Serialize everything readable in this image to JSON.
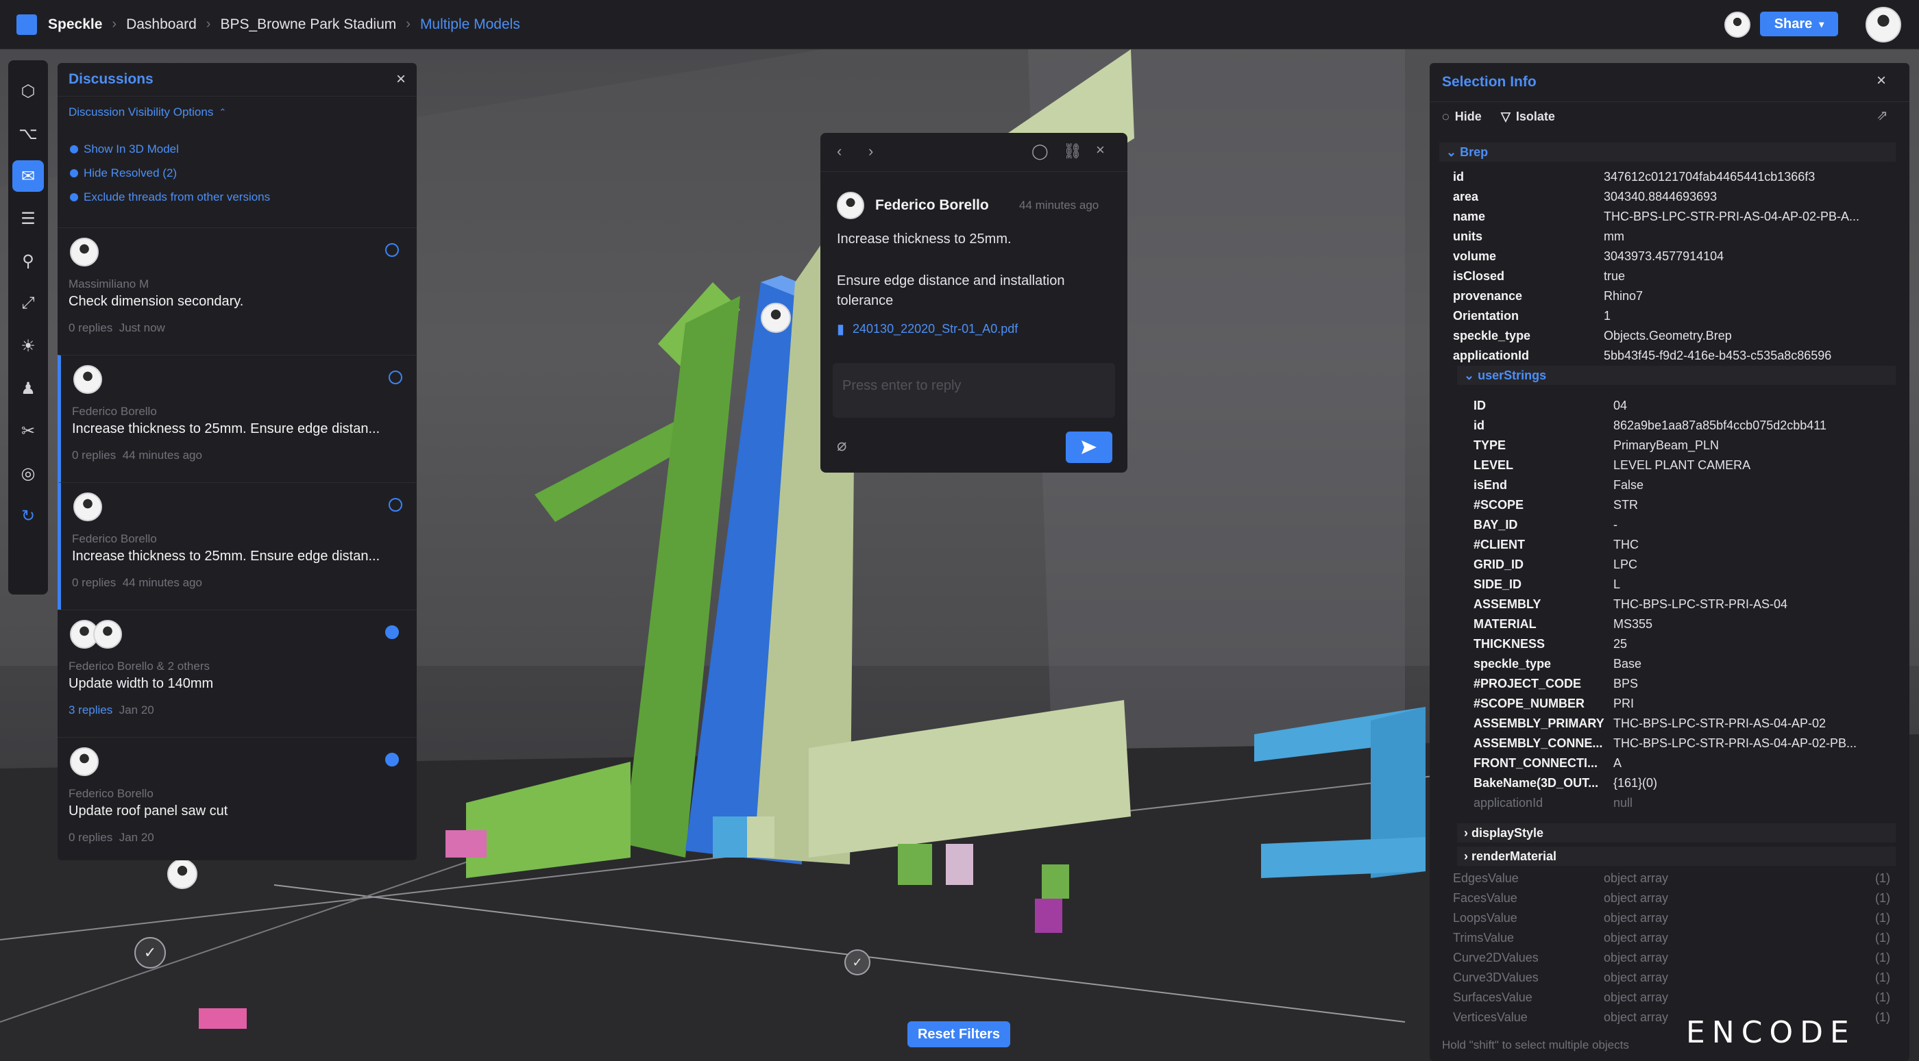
{
  "breadcrumb": {
    "brand": "Speckle",
    "items": [
      "Dashboard",
      "BPS_Browne Park Stadium"
    ],
    "current": "Multiple Models"
  },
  "header": {
    "share_label": "Share"
  },
  "discussions": {
    "title": "Discussions",
    "visibility_label": "Discussion Visibility Options",
    "options": [
      "Show In 3D Model",
      "Hide Resolved (2)",
      "Exclude threads from other versions"
    ],
    "threads": [
      {
        "author": "Massimiliano M",
        "text": "Check dimension secondary.",
        "replies": "0 replies",
        "time": "Just now"
      },
      {
        "author": "Federico Borello",
        "text": "Increase thickness to 25mm. Ensure edge distan...",
        "replies": "0 replies",
        "time": "44 minutes ago"
      },
      {
        "author": "Federico Borello",
        "text": "Increase thickness to 25mm. Ensure edge distan...",
        "replies": "0 replies",
        "time": "44 minutes ago"
      },
      {
        "author": "Federico Borello & 2 others",
        "text": "Update width to 140mm",
        "replies": "3 replies",
        "time": "Jan 20"
      },
      {
        "author": "Federico Borello",
        "text": "Update roof panel saw cut",
        "replies": "0 replies",
        "time": "Jan 20"
      }
    ]
  },
  "comment": {
    "author": "Federico Borello",
    "time": "44 minutes ago",
    "line1": "Increase thickness to 25mm.",
    "line2": "Ensure edge distance and installation tolerance",
    "attachment": "240130_22020_Str-01_A0.pdf",
    "reply_placeholder": "Press enter to reply"
  },
  "selection": {
    "title": "Selection Info",
    "hide_label": "Hide",
    "isolate_label": "Isolate",
    "group_brep": "Brep",
    "props": [
      [
        "id",
        "347612c0121704fab4465441cb1366f3"
      ],
      [
        "area",
        "304340.8844693693"
      ],
      [
        "name",
        "THC-BPS-LPC-STR-PRI-AS-04-AP-02-PB-A..."
      ],
      [
        "units",
        "mm"
      ],
      [
        "volume",
        "3043973.4577914104"
      ],
      [
        "isClosed",
        "true"
      ],
      [
        "provenance",
        "Rhino7"
      ],
      [
        "Orientation",
        "1"
      ],
      [
        "speckle_type",
        "Objects.Geometry.Brep"
      ],
      [
        "applicationId",
        "5bb43f45-f9d2-416e-b453-c535a8c86596"
      ]
    ],
    "group_userstrings": "userStrings",
    "userstrings": [
      [
        "ID",
        "04"
      ],
      [
        "id",
        "862a9be1aa87a85bf4ccb075d2cbb411"
      ],
      [
        "TYPE",
        "PrimaryBeam_PLN"
      ],
      [
        "LEVEL",
        "LEVEL PLANT CAMERA"
      ],
      [
        "isEnd",
        "False"
      ],
      [
        "#SCOPE",
        "STR"
      ],
      [
        "BAY_ID",
        "-"
      ],
      [
        "#CLIENT",
        "THC"
      ],
      [
        "GRID_ID",
        "LPC"
      ],
      [
        "SIDE_ID",
        "L"
      ],
      [
        "ASSEMBLY",
        "THC-BPS-LPC-STR-PRI-AS-04"
      ],
      [
        "MATERIAL",
        "MS355"
      ],
      [
        "THICKNESS",
        "25"
      ],
      [
        "speckle_type",
        "Base"
      ],
      [
        "#PROJECT_CODE",
        "BPS"
      ],
      [
        "#SCOPE_NUMBER",
        "PRI"
      ],
      [
        "ASSEMBLY_PRIMARY",
        "THC-BPS-LPC-STR-PRI-AS-04-AP-02"
      ],
      [
        "ASSEMBLY_CONNE...",
        "THC-BPS-LPC-STR-PRI-AS-04-AP-02-PB..."
      ],
      [
        "FRONT_CONNECTI...",
        "A"
      ],
      [
        "BakeName(3D_OUT...",
        "{161}(0)"
      ],
      [
        "applicationId",
        "null"
      ]
    ],
    "collapsed": [
      "displayStyle",
      "renderMaterial"
    ],
    "arrays": [
      [
        "EdgesValue",
        "object array",
        "(1)"
      ],
      [
        "FacesValue",
        "object array",
        "(1)"
      ],
      [
        "LoopsValue",
        "object array",
        "(1)"
      ],
      [
        "TrimsValue",
        "object array",
        "(1)"
      ],
      [
        "Curve2DValues",
        "object array",
        "(1)"
      ],
      [
        "Curve3DValues",
        "object array",
        "(1)"
      ],
      [
        "SurfacesValue",
        "object array",
        "(1)"
      ],
      [
        "VerticesValue",
        "object array",
        "(1)"
      ]
    ],
    "hint": "Hold \"shift\" to select multiple objects"
  },
  "reset_label": "Reset Filters",
  "watermark": "ENCODE"
}
